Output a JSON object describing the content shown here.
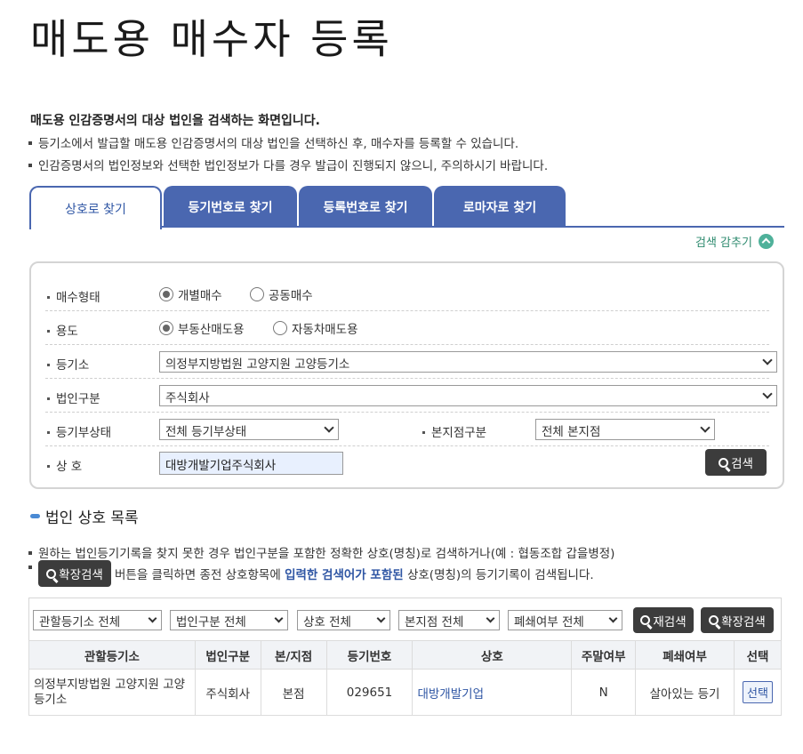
{
  "page_title": "매도용 매수자 등록",
  "intro": {
    "bold": "매도용 인감증명서의 대상 법인을 검색하는 화면입니다.",
    "lines": [
      "등기소에서 발급할 매도용 인감증명서의 대상 법인을 선택하신 후, 매수자를 등록할 수 있습니다.",
      "인감증명서의 법인정보와 선택한 법인정보가 다를 경우 발급이 진행되지 않으니, 주의하시기 바랍니다."
    ]
  },
  "tabs": [
    {
      "label": "상호로 찾기",
      "active": true
    },
    {
      "label": "등기번호로 찾기",
      "active": false
    },
    {
      "label": "등록번호로 찾기",
      "active": false
    },
    {
      "label": "로마자로 찾기",
      "active": false
    }
  ],
  "toggle_search_label": "검색 감추기",
  "form": {
    "buy_type": {
      "label": "매수형태",
      "options": [
        "개별매수",
        "공동매수"
      ],
      "selected": "개별매수"
    },
    "purpose": {
      "label": "용도",
      "options": [
        "부동산매도용",
        "자동차매도용"
      ],
      "selected": "부동산매도용"
    },
    "registry": {
      "label": "등기소",
      "value": "의정부지방법원 고양지원 고양등기소"
    },
    "corp_type": {
      "label": "법인구분",
      "value": "주식회사"
    },
    "reg_status": {
      "label": "등기부상태",
      "value": "전체 등기부상태"
    },
    "branch_type": {
      "label": "본지점구분",
      "value": "전체 본지점"
    },
    "company_name": {
      "label": "상 호",
      "value": "대방개발기업주식회사"
    },
    "search_button": "검색"
  },
  "list": {
    "title": "법인 상호 목록",
    "note1": "원하는 법인등기기록을 찾지 못한 경우 법인구분을 포함한 정확한 상호(명칭)로 검색하거나(예 : 협동조합 갑을병정)",
    "note2_button": "확장검색",
    "note2_pre": "버튼을 클릭하면 종전 상호항목에",
    "note2_highlight": "입력한 검색어가 포함된",
    "note2_post": "상호(명칭)의 등기기록이 검색됩니다.",
    "filters": [
      "관할등기소 전체",
      "법인구분 전체",
      "상호 전체",
      "본지점 전체",
      "폐쇄여부 전체"
    ],
    "research_button": "재검색",
    "extended_button": "확장검색",
    "columns": [
      "관할등기소",
      "법인구분",
      "본/지점",
      "등기번호",
      "상호",
      "주말여부",
      "폐쇄여부",
      "선택"
    ],
    "rows": [
      {
        "registry": "의정부지방법원 고양지원 고양등기소",
        "corp_type": "주식회사",
        "branch": "본점",
        "reg_no": "029651",
        "name": "대방개발기업",
        "weekend": "N",
        "closed": "살아있는 등기",
        "select": "선택"
      }
    ]
  }
}
